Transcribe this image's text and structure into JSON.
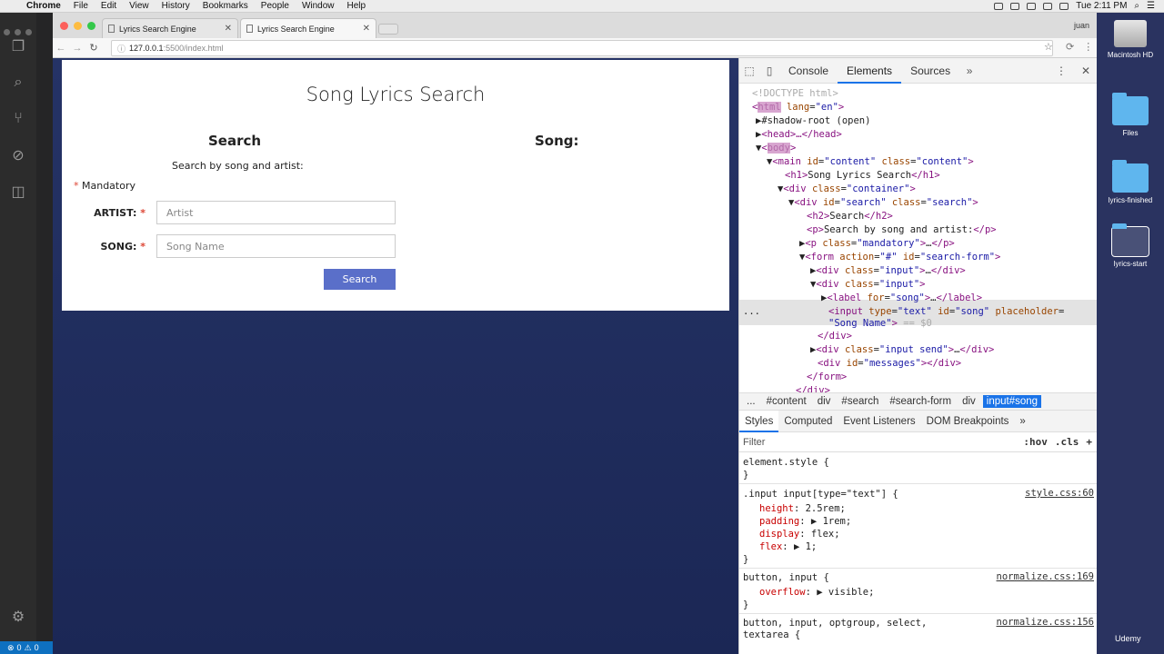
{
  "menubar": {
    "app": "Chrome",
    "items": [
      "File",
      "Edit",
      "View",
      "History",
      "Bookmarks",
      "People",
      "Window",
      "Help"
    ],
    "clock": "Tue 2:11 PM"
  },
  "vscode": {
    "status": {
      "errors": "0",
      "warnings": "0"
    }
  },
  "chrome": {
    "tabs": [
      {
        "title": "Lyrics Search Engine"
      },
      {
        "title": "Lyrics Search Engine"
      }
    ],
    "user": "juan",
    "url_host": "127.0.0.1",
    "url_path": ":5500/index.html"
  },
  "page": {
    "title": "Song Lyrics Search",
    "search_heading": "Search",
    "song_heading": "Song:",
    "description": "Search by song and artist:",
    "mandatory": "Mandatory",
    "artist_label": "ARTIST:",
    "artist_placeholder": "Artist",
    "song_label": "SONG:",
    "song_placeholder": "Song Name",
    "search_button": "Search",
    "asterisk": "*"
  },
  "devtools": {
    "tabs": [
      "Console",
      "Elements",
      "Sources"
    ],
    "dom": {
      "doctype": "<!DOCTYPE html>",
      "html_lang": "en",
      "shadow_root": "#shadow-root (open)",
      "head": "<head>…</head>",
      "main_id": "content",
      "main_class": "content",
      "h1_text": "Song Lyrics Search",
      "container_class": "container",
      "search_id": "search",
      "search_class": "search",
      "h2_text": "Search",
      "p_text": "Search by song and artist:",
      "p_class": "mandatory",
      "form_action": "#",
      "form_id": "search-form",
      "div_input_class": "input",
      "label_for": "song",
      "input_type": "text",
      "input_id": "song",
      "input_placeholder": "Song Name",
      "eq": "== $0",
      "div_send_class": "input send",
      "messages_id": "messages",
      "ellipsis": "..."
    },
    "breadcrumbs": [
      "...",
      "#content",
      "div",
      "#search",
      "#search-form",
      "div",
      "input#song"
    ],
    "subtabs": [
      "Styles",
      "Computed",
      "Event Listeners",
      "DOM Breakpoints"
    ],
    "filter_placeholder": "Filter",
    "filter_hov": ":hov",
    "filter_cls": ".cls",
    "styles": {
      "element_style": "element.style {",
      "rule1_selector": ".input input[type=\"text\"] {",
      "rule1_source": "style.css:60",
      "rule1_props": [
        {
          "name": "height",
          "value": "2.5rem;"
        },
        {
          "name": "padding",
          "value": "▶ 1rem;"
        },
        {
          "name": "display",
          "value": "flex;"
        },
        {
          "name": "flex",
          "value": "▶ 1;"
        }
      ],
      "rule2_selector": "button, input {",
      "rule2_source": "normalize.css:169",
      "rule2_prop_name": "overflow",
      "rule2_prop_value": "▶ visible;",
      "rule3_selector": "button, input, optgroup, select,",
      "rule3_selector_2": "textarea {",
      "rule3_source": "normalize.css:156",
      "close": "}"
    }
  },
  "desktop": {
    "items": [
      {
        "label": "Macintosh HD"
      },
      {
        "label": "Files"
      },
      {
        "label": "lyrics-finished"
      },
      {
        "label": "lyrics-start"
      }
    ],
    "watermark": "Udemy"
  },
  "colors": {
    "accent_button": "#5a6fc9",
    "devtools_active": "#1a73e8",
    "page_background": "#1e2a59"
  }
}
